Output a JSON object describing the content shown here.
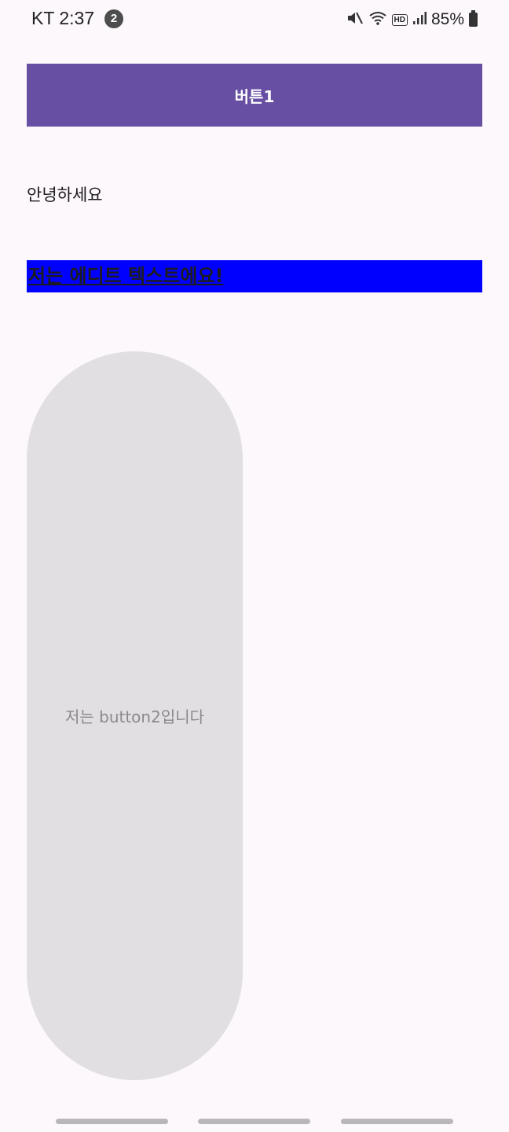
{
  "status_bar": {
    "carrier_time": "KT 2:37",
    "notification_count": "2",
    "hd_label": "HD",
    "battery_percent": "85%",
    "icons": [
      "mute-icon",
      "wifi-icon",
      "hd-icon",
      "signal-icon",
      "battery-icon"
    ]
  },
  "main": {
    "button1_label": "버튼1",
    "greeting_text": "안녕하세요",
    "edit_text_value": "저는 에디트 텍스트에요!",
    "button2_label": "저는 button2입니다"
  },
  "colors": {
    "button1_bg": "#6750a4",
    "edit_text_bg": "#0000ff",
    "button2_bg": "#e1dfe2",
    "page_bg": "#fdf8fc"
  }
}
